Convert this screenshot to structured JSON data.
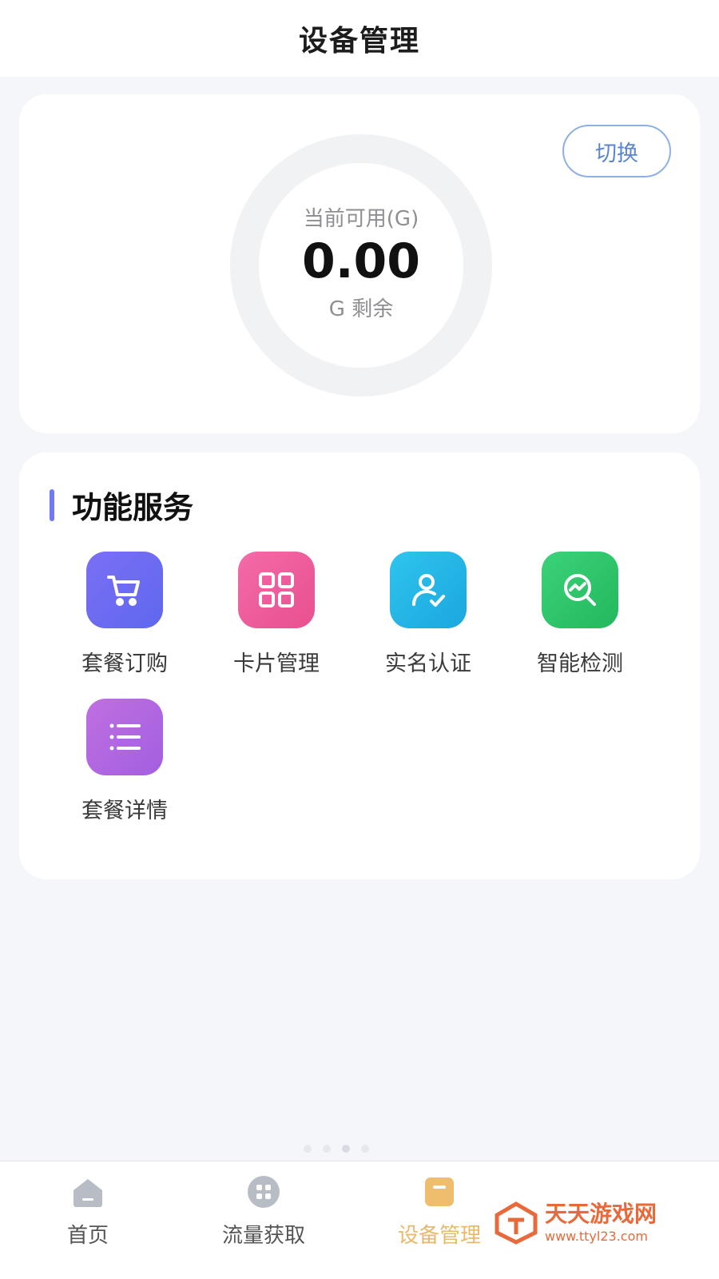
{
  "header": {
    "title": "设备管理"
  },
  "usage": {
    "switch_label": "切换",
    "label": "当前可用(G)",
    "value": "0.00",
    "unit": "G 剩余",
    "ring_track_color": "#f1f2f4"
  },
  "services": {
    "title": "功能服务",
    "accent_color": "#6f79f2",
    "items": [
      {
        "label": "套餐订购",
        "icon": "cart-icon",
        "color": "#6b6ef2"
      },
      {
        "label": "卡片管理",
        "icon": "grid-icon",
        "color": "#ec5fa0"
      },
      {
        "label": "实名认证",
        "icon": "user-check-icon",
        "color": "#23b4e6"
      },
      {
        "label": "智能检测",
        "icon": "search-chart-icon",
        "color": "#2fc86b"
      },
      {
        "label": "套餐详情",
        "icon": "list-icon",
        "color": "#b26de0"
      }
    ]
  },
  "tabbar": {
    "active_color": "#e8b96a",
    "items": [
      {
        "label": "首页",
        "icon": "home-icon"
      },
      {
        "label": "流量获取",
        "icon": "apps-icon"
      },
      {
        "label": "设备管理",
        "icon": "device-icon"
      }
    ]
  },
  "watermark": {
    "title": "天天游戏网",
    "url": "www.ttyl23.com"
  }
}
